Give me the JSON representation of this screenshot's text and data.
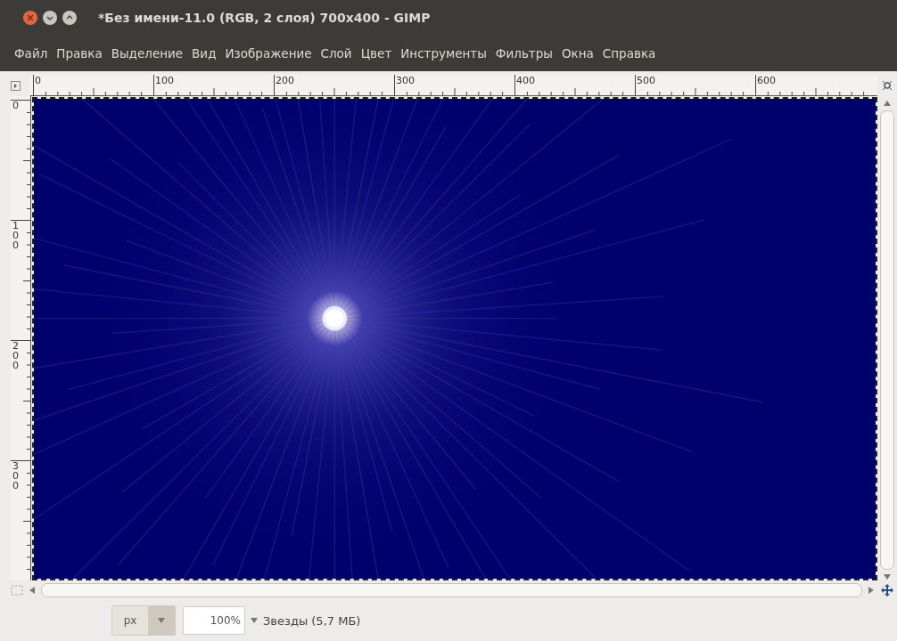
{
  "window": {
    "title": "*Без имени-11.0 (RGB, 2 слоя) 700x400 - GIMP"
  },
  "menu": [
    "Файл",
    "Правка",
    "Выделение",
    "Вид",
    "Изображение",
    "Слой",
    "Цвет",
    "Инструменты",
    "Фильтры",
    "Окна",
    "Справка"
  ],
  "top_ruler": [
    "0",
    "100",
    "200",
    "300",
    "400",
    "500",
    "600"
  ],
  "left_ruler": [
    "0",
    "100",
    "200",
    "300"
  ],
  "status_bar": {
    "unit": "px",
    "zoom": "100%",
    "info": "Звезды (5,7 МБ)"
  }
}
